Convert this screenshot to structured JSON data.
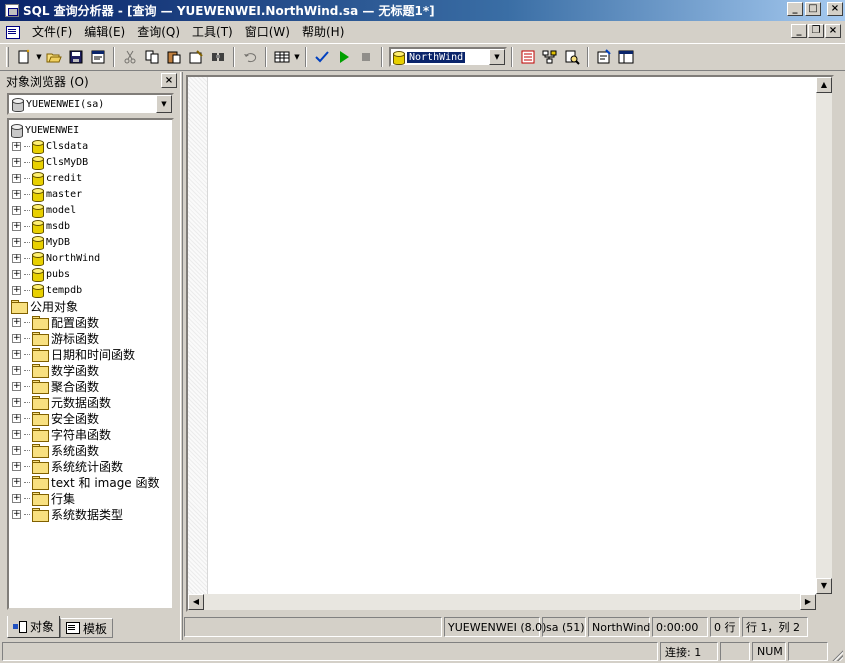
{
  "window": {
    "title": "SQL 查询分析器 - [查询 — YUEWENWEI.NorthWind.sa — 无标题1*]",
    "minimize": "_",
    "maximize": "□",
    "close": "×",
    "mdi_minimize": "_",
    "mdi_restore": "❐",
    "mdi_close": "×"
  },
  "menu": {
    "items": [
      {
        "label": "文件(F)"
      },
      {
        "label": "编辑(E)"
      },
      {
        "label": "查询(Q)"
      },
      {
        "label": "工具(T)"
      },
      {
        "label": "窗口(W)"
      },
      {
        "label": "帮助(H)"
      }
    ]
  },
  "toolbar": {
    "database_value": "NorthWind",
    "icons": [
      "new-query-icon",
      "open-icon",
      "save-icon",
      "load-script-icon",
      "cut-icon",
      "copy-icon",
      "paste-icon",
      "clear-window-icon",
      "find-icon",
      "undo-icon",
      "results-mode-icon",
      "parse-check-icon",
      "execute-icon",
      "cancel-execute-icon",
      "database-combo-icon",
      "object-search-icon",
      "show-execution-plan-icon",
      "show-server-trace-icon",
      "properties-icon",
      "object-browser-icon"
    ]
  },
  "object_browser": {
    "title": "对象浏览器 (O)",
    "close": "×",
    "server_select": "YUEWENWEI(sa)",
    "server_node": "YUEWENWEI",
    "databases": [
      "Clsdata",
      "ClsMyDB",
      "credit",
      "master",
      "model",
      "msdb",
      "MyDB",
      "NorthWind",
      "pubs",
      "tempdb"
    ],
    "common_objects_label": "公用对象",
    "common_objects": [
      "配置函数",
      "游标函数",
      "日期和时间函数",
      "数学函数",
      "聚合函数",
      "元数据函数",
      "安全函数",
      "字符串函数",
      "系统函数",
      "系统统计函数",
      "text 和 image 函数",
      "行集",
      "系统数据类型"
    ],
    "tabs": [
      {
        "label": "对象",
        "active": true
      },
      {
        "label": "模板",
        "active": false
      }
    ]
  },
  "editor": {
    "content": ""
  },
  "query_status": {
    "server": "YUEWENWEI (8.0)",
    "user": "sa (51)",
    "database": "NorthWind",
    "elapsed": "0:00:00",
    "rows": "0 行",
    "position": "行 1，列 2"
  },
  "app_status": {
    "connections": "连接: 1",
    "numlock": "NUM"
  },
  "colors": {
    "titlebar_start": "#0a246a",
    "titlebar_end": "#a6caf0",
    "chrome": "#d4d0c8",
    "selection": "#0a246a"
  }
}
